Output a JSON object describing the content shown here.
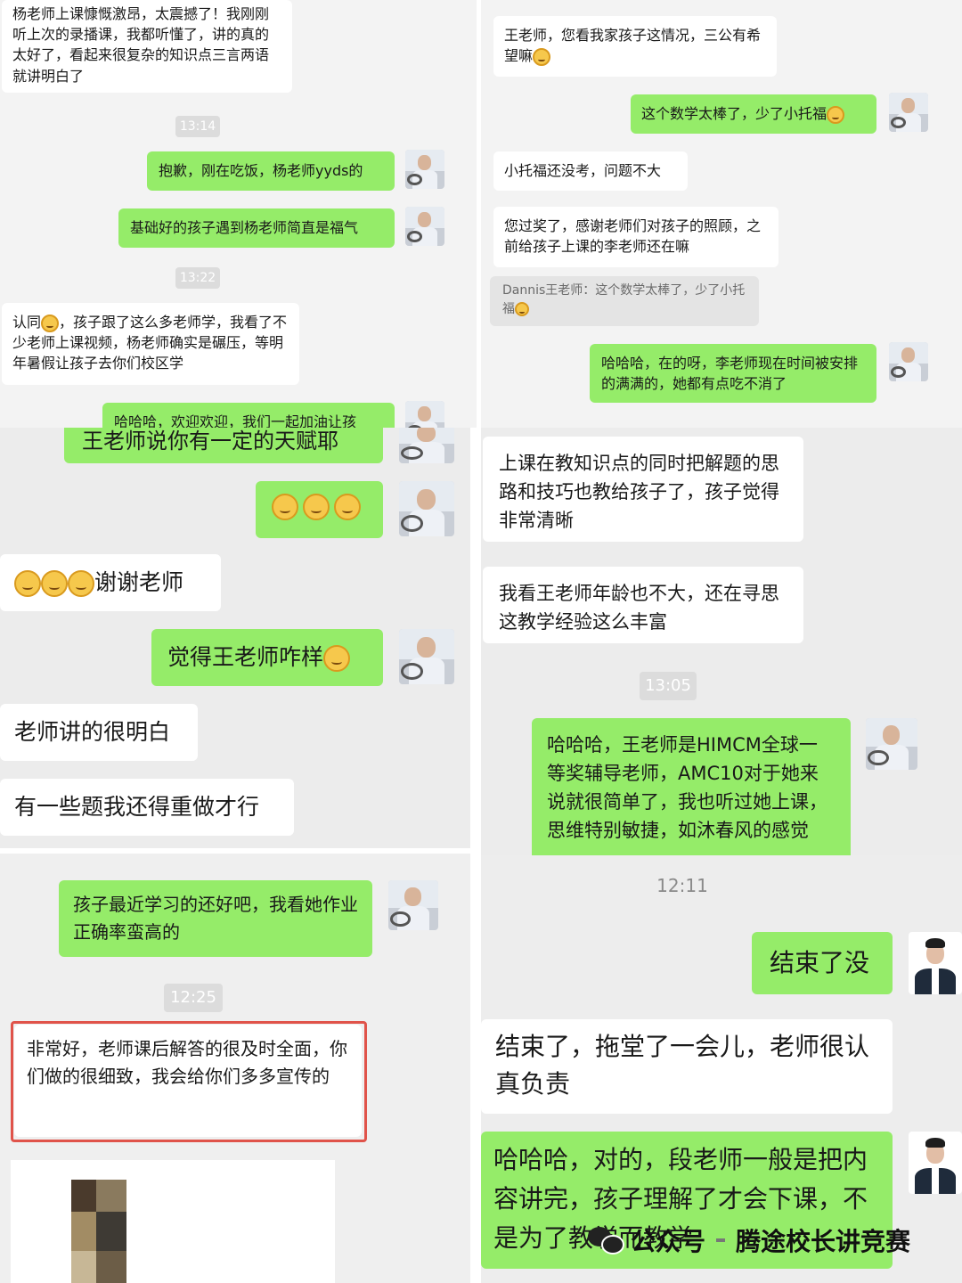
{
  "panel1": {
    "msg_top": "杨老师上课慷慨激昂，太震撼了！我刚刚听上次的录播课，我都听懂了，讲的真的太好了，看起来很复杂的知识点三言两语就讲明白了",
    "time1": "13:14",
    "msg_g1": "抱歉，刚在吃饭，杨老师yyds的",
    "msg_g2": "基础好的孩子遇到杨老师简直是福气",
    "time2": "13:22",
    "msg_w2_a": "认同",
    "msg_w2_b": "，孩子跟了这么多老师学，我看了不少老师上课视频，杨老师确实是碾压，等明年暑假让孩子去你们校区学",
    "msg_g3_partial": "哈哈哈，欢迎欢迎，我们一起加油让孩"
  },
  "panel2": {
    "msg_w1": "王老师，您看我家孩子这情况，三公有希望嘛",
    "msg_g1": "这个数学太棒了，少了小托福",
    "msg_w2": "小托福还没考，问题不大",
    "msg_w3": "您过奖了，感谢老师们对孩子的照顾，之前给孩子上课的李老师还在嘛",
    "quote": "Dannis王老师：这个数学太棒了，少了小托福",
    "msg_g2": "哈哈哈，在的呀，李老师现在时间被安排的满满的，她都有点吃不消了"
  },
  "panel3": {
    "msg_g_top": "王老师说你有一定的天赋耶",
    "msg_w1": "谢谢老师",
    "msg_g2": "觉得王老师咋样",
    "msg_w2": "老师讲的很明白",
    "msg_w3": "有一些题我还得重做才行"
  },
  "panel4": {
    "msg_w1": "上课在教知识点的同时把解题的思路和技巧也教给孩子了，孩子觉得非常清晰",
    "msg_w2": "我看王老师年龄也不大，还在寻思这教学经验这么丰富",
    "time": "13:05",
    "msg_g1": "哈哈哈，王老师是HIMCM全球一等奖辅导老师，AMC10对于她来说就很简单了，我也听过她上课，思维特别敏捷，如沐春风的感觉"
  },
  "panel5": {
    "msg_g1": "孩子最近学习的还好吧，我看她作业正确率蛮高的",
    "time": "12:25",
    "msg_w1": "非常好，老师课后解答的很及时全面，你们做的很细致，我会给你们多多宣传的"
  },
  "panel6": {
    "time": "12:11",
    "msg_g1": "结束了没",
    "msg_w1": "结束了，拖堂了一会儿，老师很认真负责",
    "msg_g2": "哈哈哈，对的，段老师一般是把内容讲完，孩子理解了才会下课，不是为了教学而教学"
  },
  "watermark": {
    "prefix": "公众号",
    "name": "腾途校长讲竞赛"
  },
  "colors": {
    "green_bubble": "#95ec69",
    "white_bubble": "#ffffff",
    "highlight_box": "#e0534a"
  }
}
